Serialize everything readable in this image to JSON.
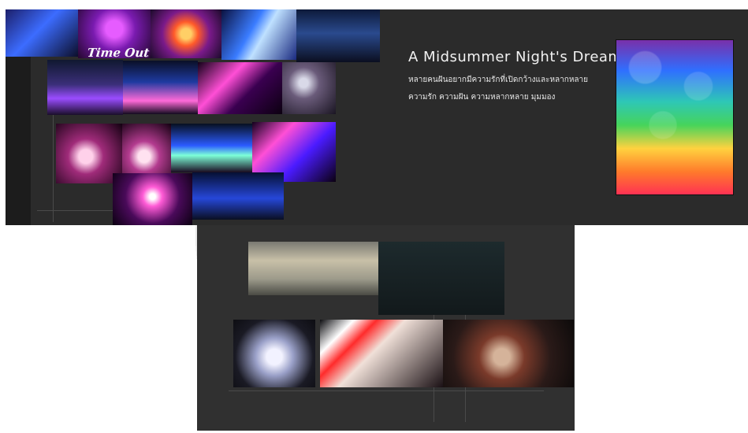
{
  "poster": {
    "title": "A Midsummer Night's Dream",
    "subtitle_line1": "หลายคนฝันอยากมีความรักที่เปิดกว้างและหลากหลาย",
    "subtitle_line2": "ความรัก ความฝัน ความหลากหลาย มุมมอง",
    "logo_text": "Time Out"
  },
  "colors": {
    "panel_dark": "#2b2b2b",
    "lower_panel": "#303030",
    "accent_purple": "#b84cff",
    "accent_blue": "#2f63ff",
    "accent_pink": "#ff4fd6"
  }
}
